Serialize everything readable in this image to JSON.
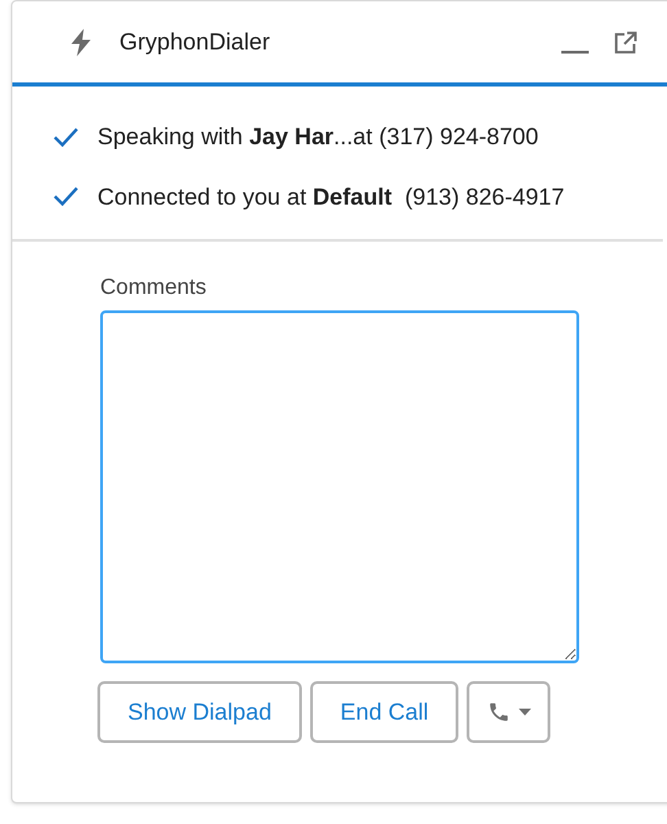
{
  "window": {
    "title": "GryphonDialer"
  },
  "status_lines": [
    {
      "text": "Speaking with **Jay Har**...at (317) 924-8700"
    },
    {
      "text": "Connected to you at **Default**  (913) 826-4917"
    }
  ],
  "comments": {
    "label": "Comments",
    "focused": true
  },
  "buttons": [
    {
      "kind": "text",
      "label": "Show Dialpad"
    },
    {
      "kind": "text",
      "label": "End Call"
    },
    {
      "kind": "phone-menu"
    }
  ]
}
